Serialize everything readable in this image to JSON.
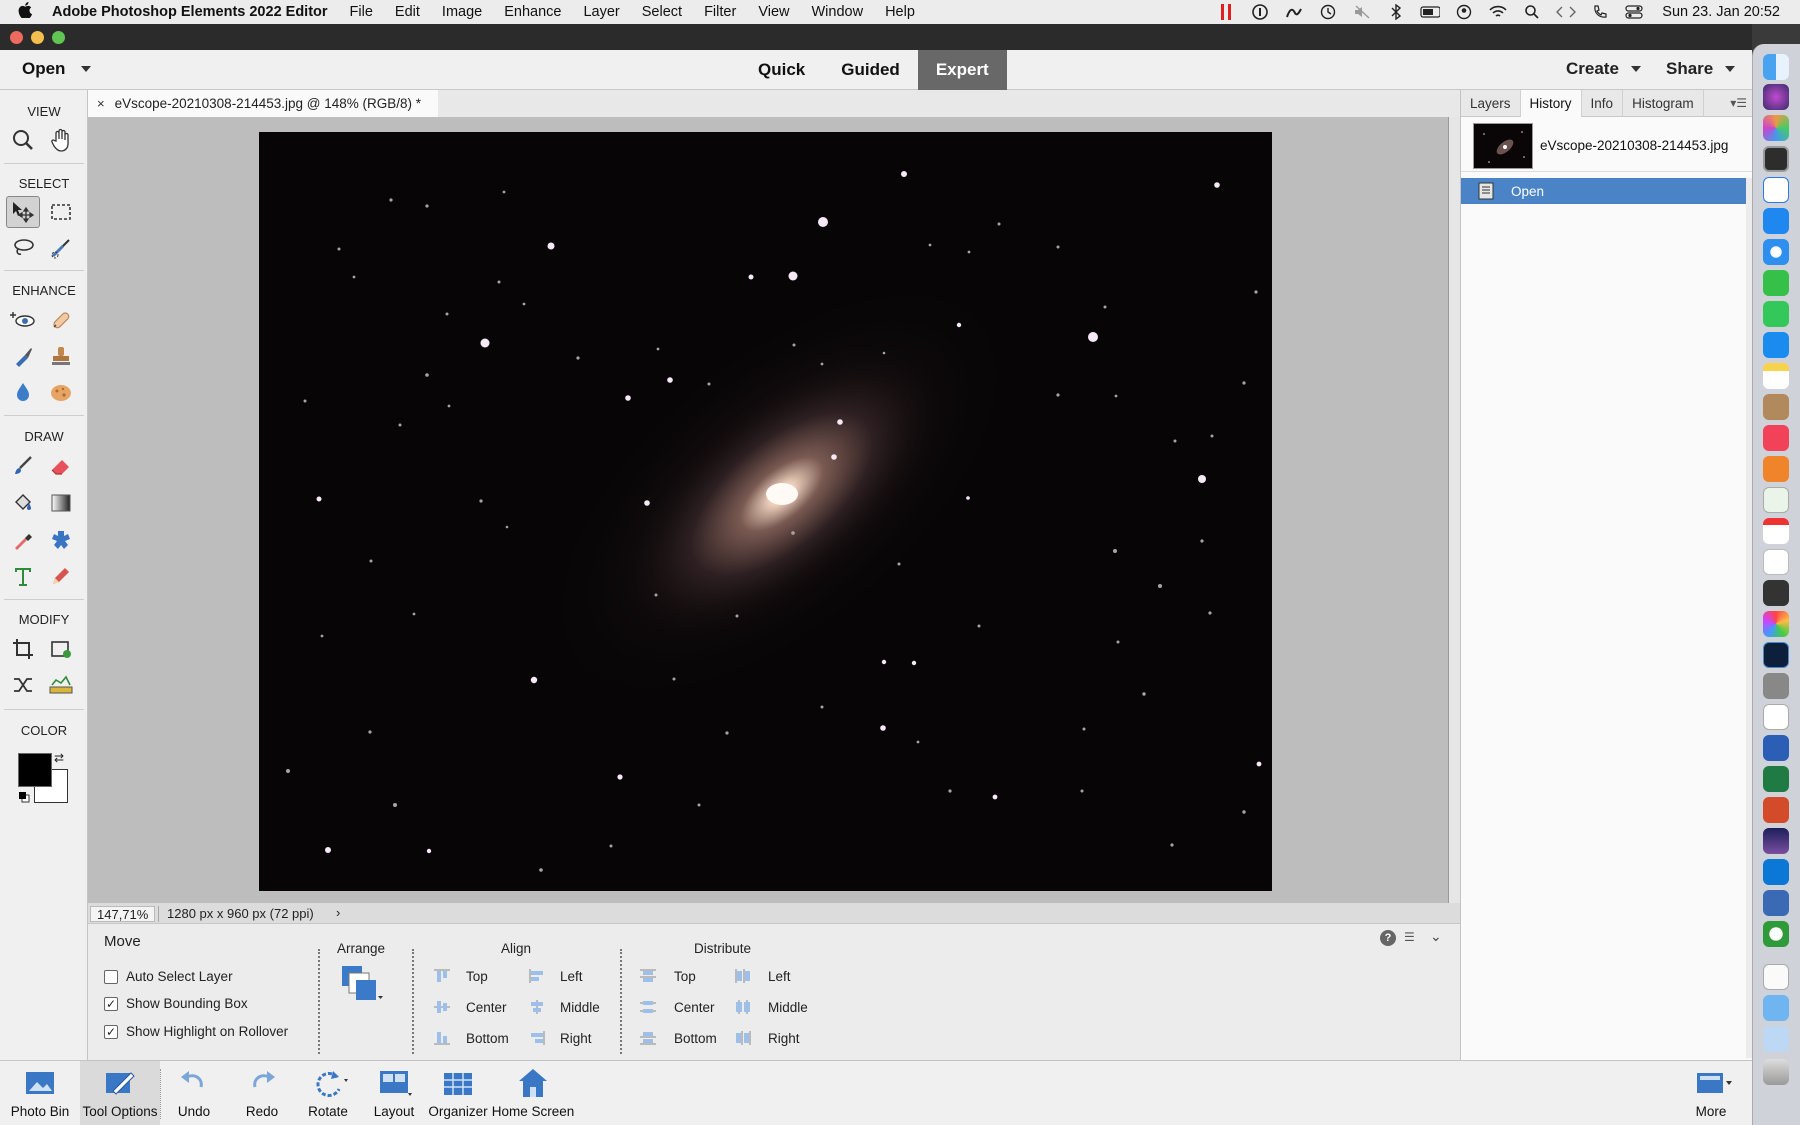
{
  "menubar": {
    "app_name": "Adobe Photoshop Elements 2022 Editor",
    "items": [
      "File",
      "Edit",
      "Image",
      "Enhance",
      "Layer",
      "Select",
      "Filter",
      "View",
      "Window",
      "Help"
    ],
    "clock": "Sun 23. Jan  20:52"
  },
  "header": {
    "open_label": "Open",
    "modes": [
      "Quick",
      "Guided",
      "Expert"
    ],
    "active_mode": "Expert",
    "create_label": "Create",
    "share_label": "Share"
  },
  "toolbox": {
    "sections": {
      "view": "VIEW",
      "select": "SELECT",
      "enhance": "ENHANCE",
      "draw": "DRAW",
      "modify": "MODIFY",
      "color": "COLOR"
    },
    "foreground_color": "#000000",
    "background_color": "#ffffff"
  },
  "document": {
    "tab_title": "eVscope-20210308-214453.jpg @ 148% (RGB/8) *",
    "zoom": "147,71%",
    "dimensions": "1280 px x 960 px (72 ppi)"
  },
  "tool_options": {
    "tool_name": "Move",
    "checkboxes": [
      {
        "label": "Auto Select Layer",
        "checked": false
      },
      {
        "label": "Show Bounding Box",
        "checked": true
      },
      {
        "label": "Show Highlight on Rollover",
        "checked": true
      }
    ],
    "arrange_label": "Arrange",
    "align_label": "Align",
    "align_items": [
      "Top",
      "Center",
      "Bottom",
      "Left",
      "Middle",
      "Right"
    ],
    "distribute_label": "Distribute",
    "distribute_items": [
      "Top",
      "Center",
      "Bottom",
      "Left",
      "Middle",
      "Right"
    ]
  },
  "panel": {
    "tabs": [
      "Layers",
      "History",
      "Info",
      "Histogram"
    ],
    "active_tab": "History",
    "snapshot_name": "eVscope-20210308-214453.jpg",
    "history_items": [
      "Open"
    ]
  },
  "taskbar": {
    "photo_bin": "Photo Bin",
    "tool_options": "Tool Options",
    "undo": "Undo",
    "redo": "Redo",
    "rotate": "Rotate",
    "layout": "Layout",
    "organizer": "Organizer",
    "home_screen": "Home Screen",
    "more": "More"
  },
  "colors": {
    "accent_selection": "#4a84c6",
    "active_mode_bg": "#686868"
  }
}
